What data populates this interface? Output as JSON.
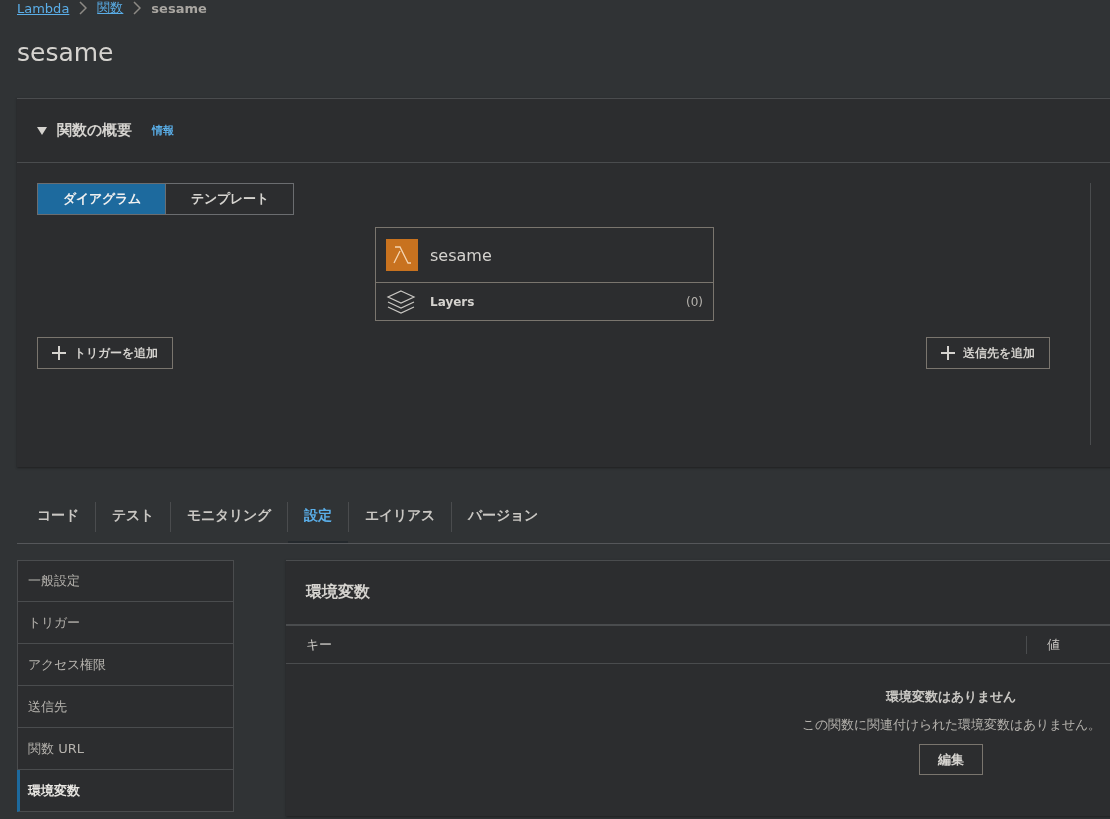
{
  "breadcrumb": [
    {
      "label": "Lambda",
      "link": true
    },
    {
      "label": "関数",
      "link": true
    },
    {
      "label": "sesame",
      "link": false
    }
  ],
  "title": "sesame",
  "overview": {
    "expanded": true,
    "heading": "関数の概要",
    "info": "情報",
    "views": [
      {
        "label": "ダイアグラム",
        "selected": true
      },
      {
        "label": "テンプレート",
        "selected": false
      }
    ],
    "function": {
      "name": "sesame",
      "layers_label": "Layers",
      "layers_count": "(0)"
    },
    "add_trigger": "トリガーを追加",
    "add_destination": "送信先を追加"
  },
  "tabs": [
    {
      "label": "コード",
      "selected": false
    },
    {
      "label": "テスト",
      "selected": false
    },
    {
      "label": "モニタリング",
      "selected": false
    },
    {
      "label": "設定",
      "selected": true
    },
    {
      "label": "エイリアス",
      "selected": false
    },
    {
      "label": "バージョン",
      "selected": false
    }
  ],
  "settings_nav": [
    {
      "label": "一般設定",
      "selected": false
    },
    {
      "label": "トリガー",
      "selected": false
    },
    {
      "label": "アクセス権限",
      "selected": false
    },
    {
      "label": "送信先",
      "selected": false
    },
    {
      "label": "関数 URL",
      "selected": false
    },
    {
      "label": "環境変数",
      "selected": true
    }
  ],
  "env_panel": {
    "heading": "環境変数",
    "columns": [
      "キー",
      "値"
    ],
    "empty_title": "環境変数はありません",
    "empty_text": "この関数に関連付けられた環境変数はありません。",
    "edit_button": "編集"
  }
}
